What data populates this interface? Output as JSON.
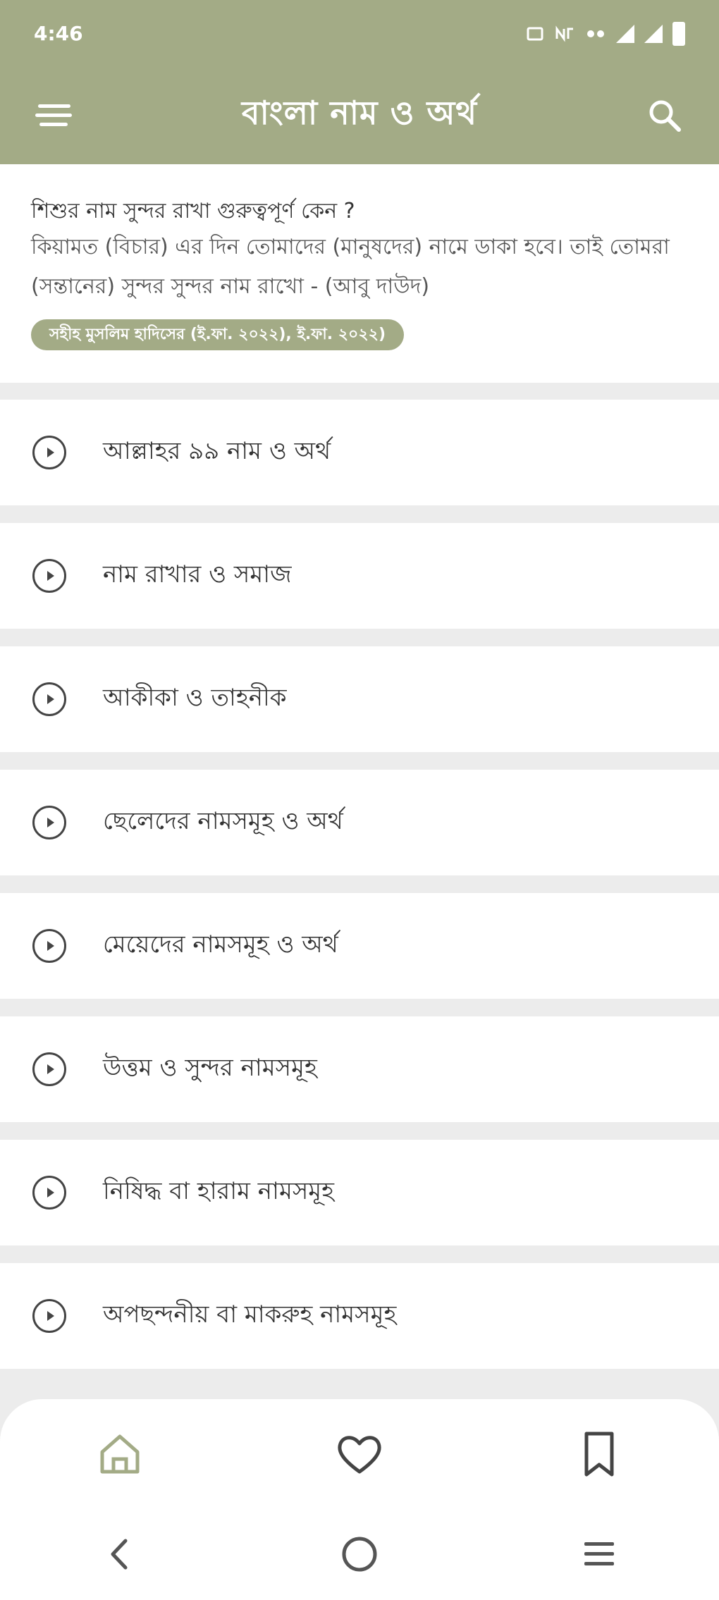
{
  "status_bar": {
    "time": "4:46",
    "icons": [
      "cast-icon",
      "data-icon",
      "network-icon",
      "signal-icon",
      "signal-icon",
      "battery-icon"
    ]
  },
  "app_bar": {
    "title": "বাংলা নাম ও অর্থ",
    "menu_icon": "menu-icon",
    "search_icon": "search-icon"
  },
  "info_card": {
    "question": "শিশুর নাম সুন্দর রাখা গুরুত্বপূর্ণ কেন ?",
    "answer": "কিয়ামত (বিচার) এর দিন তোমাদের (মানুষদের) নামে ডাকা হবে। তাই তোমরা (সন্তানের) সুন্দর সুন্দর নাম রাখো - (আবু দাউদ)",
    "source": "সহীহ মুসলিম হাদিসের (ই.ফা. ২০২২), ই.ফা. ২০২২)"
  },
  "list_items": [
    {
      "label": "আল্লাহর ৯৯ নাম ও অর্থ"
    },
    {
      "label": "নাম রাখার ও সমাজ"
    },
    {
      "label": "আকীকা ও তাহনীক"
    },
    {
      "label": "ছেলেদের নামসমূহ ও অর্থ"
    },
    {
      "label": "মেয়েদের নামসমূহ ও অর্থ"
    },
    {
      "label": "উত্তম ও সুন্দর নামসমূহ"
    },
    {
      "label": "নিষিদ্ধ বা হারাম নামসমূহ"
    },
    {
      "label": "অপছন্দনীয় বা মাকরুহ নামসমূহ"
    }
  ],
  "bottom_nav": {
    "items": [
      "home-icon",
      "heart-icon",
      "bookmark-icon"
    ]
  },
  "system_nav": {
    "items": [
      "back-icon",
      "home-circle-icon",
      "recents-icon"
    ]
  },
  "colors": {
    "accent": "#a3ab86",
    "background": "#ececec"
  }
}
